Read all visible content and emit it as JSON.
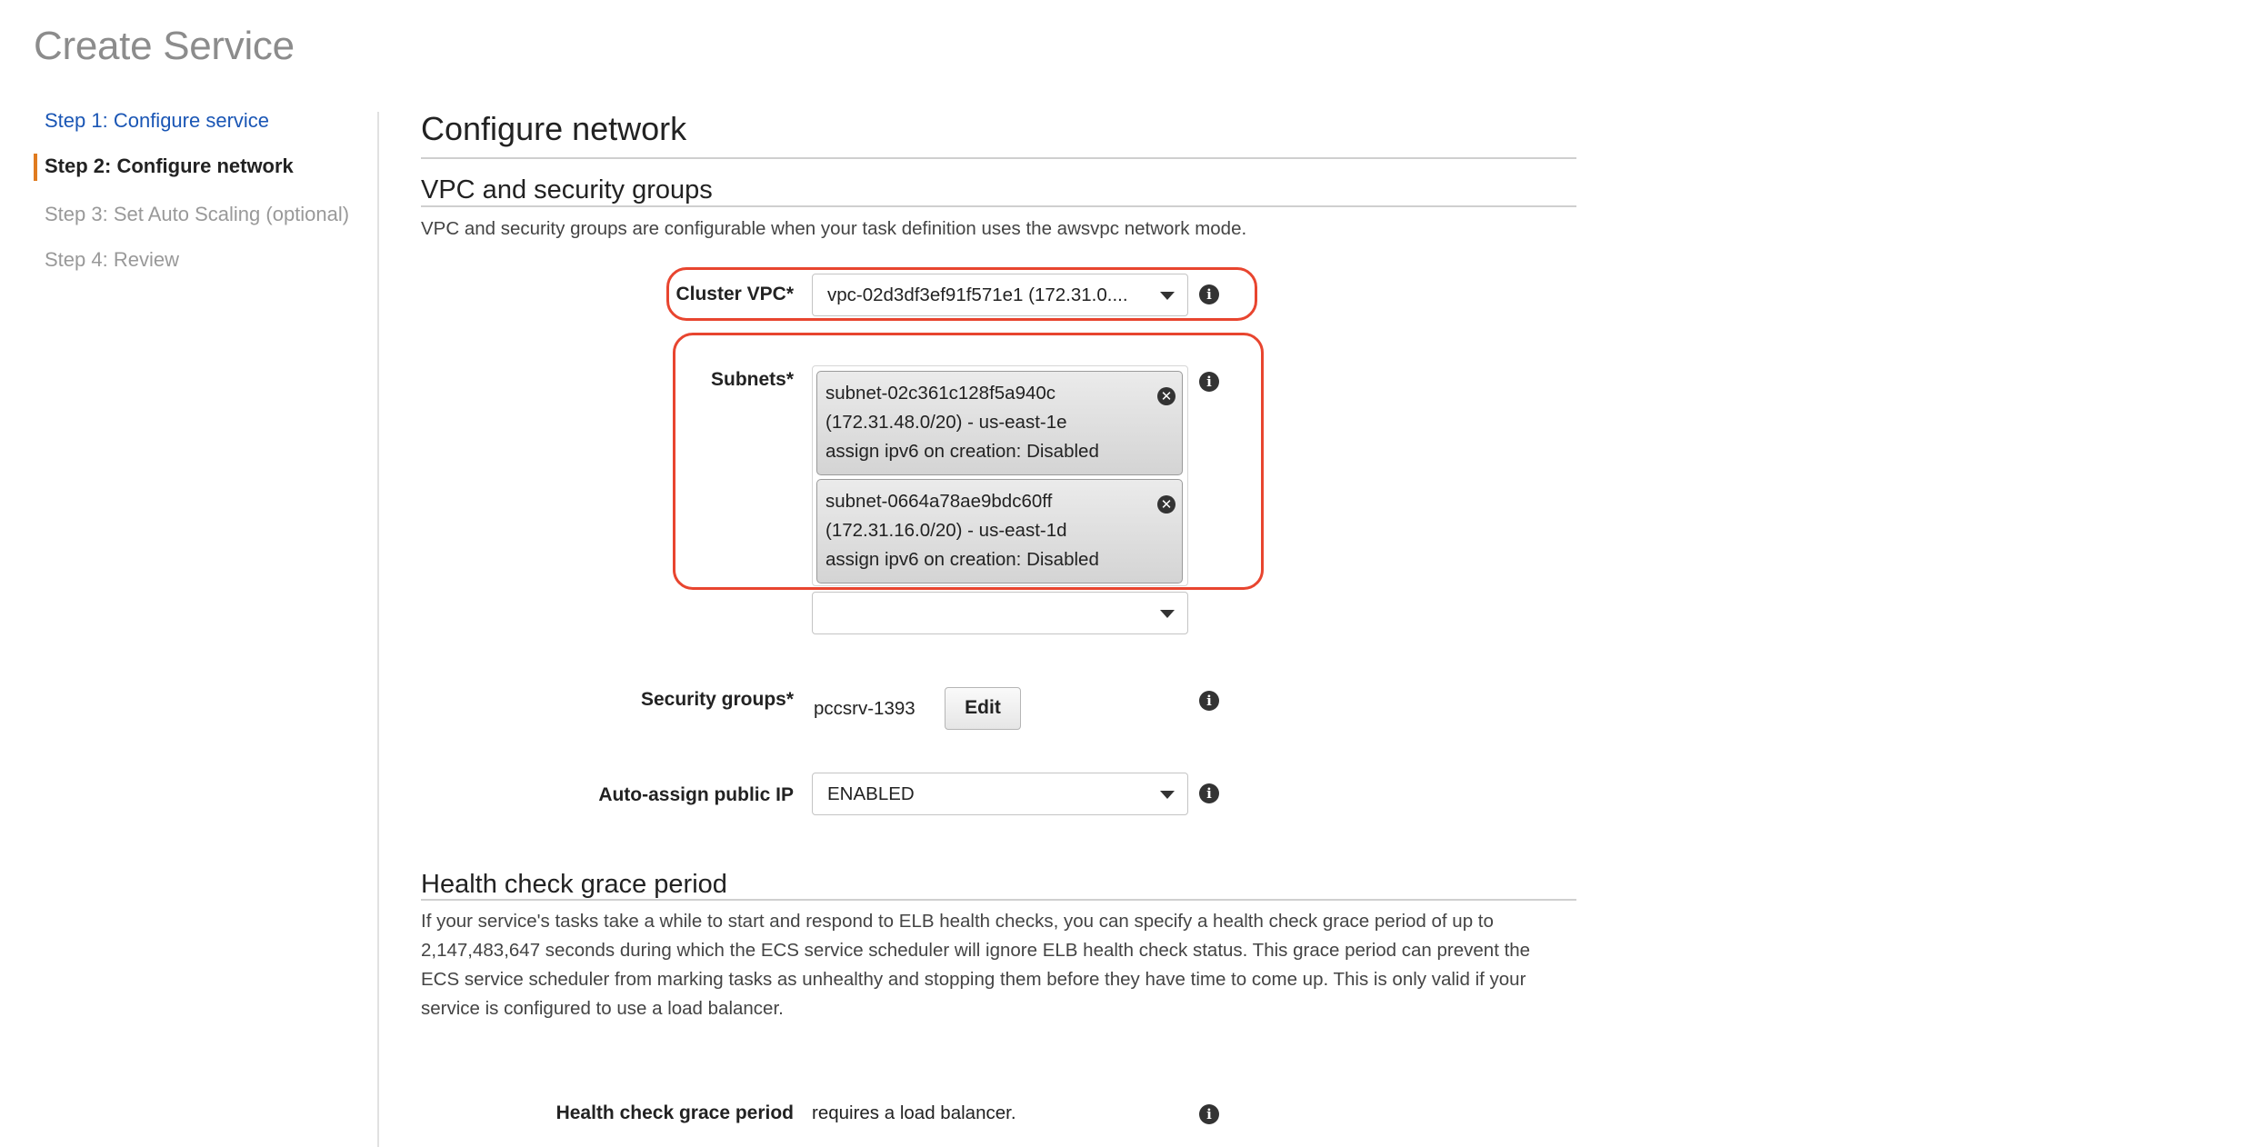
{
  "page": {
    "title": "Create Service"
  },
  "sidebar": {
    "items": [
      {
        "label": "Step 1: Configure service",
        "state": "link"
      },
      {
        "label": "Step 2: Configure network",
        "state": "active"
      },
      {
        "label": "Step 3: Set Auto Scaling (optional)",
        "state": "disabled"
      },
      {
        "label": "Step 4: Review",
        "state": "disabled"
      }
    ]
  },
  "main": {
    "heading": "Configure network",
    "vpc_section": {
      "heading": "VPC and security groups",
      "description": "VPC and security groups are configurable when your task definition uses the awsvpc network mode.",
      "cluster_vpc": {
        "label": "Cluster VPC*",
        "value": "vpc-02d3df3ef91f571e1 (172.31.0...."
      },
      "subnets": {
        "label": "Subnets*",
        "selected": [
          {
            "id": "subnet-02c361c128f5a940c",
            "cidr_zone": "(172.31.48.0/20) - us-east-1e",
            "ipv6": "assign ipv6 on creation: Disabled"
          },
          {
            "id": "subnet-0664a78ae9bdc60ff",
            "cidr_zone": "(172.31.16.0/20) - us-east-1d",
            "ipv6": "assign ipv6 on creation: Disabled"
          }
        ],
        "add_select_value": ""
      },
      "security_groups": {
        "label": "Security groups*",
        "value": "pccsrv-1393",
        "edit_label": "Edit"
      },
      "auto_assign_ip": {
        "label": "Auto-assign public IP",
        "value": "ENABLED"
      }
    },
    "health_section": {
      "heading": "Health check grace period",
      "description": "If your service's tasks take a while to start and respond to ELB health checks, you can specify a health check grace period of up to 2,147,483,647 seconds during which the ECS service scheduler will ignore ELB health check status. This grace period can prevent the ECS service scheduler from marking tasks as unhealthy and stopping them before they have time to come up. This is only valid if your service is configured to use a load balancer.",
      "field_label": "Health check grace period",
      "field_value": "requires a load balancer."
    }
  },
  "icons": {
    "info": "i",
    "remove": "✕"
  },
  "colors": {
    "highlight": "#e8452f",
    "active_step_marker": "#e07b1f",
    "link": "#1a56b5"
  }
}
